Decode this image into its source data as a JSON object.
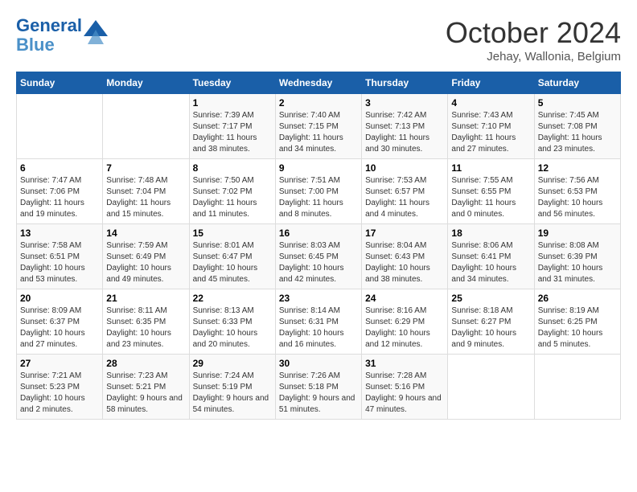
{
  "header": {
    "logo_general": "General",
    "logo_blue": "Blue",
    "month_title": "October 2024",
    "location": "Jehay, Wallonia, Belgium"
  },
  "weekdays": [
    "Sunday",
    "Monday",
    "Tuesday",
    "Wednesday",
    "Thursday",
    "Friday",
    "Saturday"
  ],
  "weeks": [
    [
      {
        "day": "",
        "sunrise": "",
        "sunset": "",
        "daylight": ""
      },
      {
        "day": "",
        "sunrise": "",
        "sunset": "",
        "daylight": ""
      },
      {
        "day": "1",
        "sunrise": "Sunrise: 7:39 AM",
        "sunset": "Sunset: 7:17 PM",
        "daylight": "Daylight: 11 hours and 38 minutes."
      },
      {
        "day": "2",
        "sunrise": "Sunrise: 7:40 AM",
        "sunset": "Sunset: 7:15 PM",
        "daylight": "Daylight: 11 hours and 34 minutes."
      },
      {
        "day": "3",
        "sunrise": "Sunrise: 7:42 AM",
        "sunset": "Sunset: 7:13 PM",
        "daylight": "Daylight: 11 hours and 30 minutes."
      },
      {
        "day": "4",
        "sunrise": "Sunrise: 7:43 AM",
        "sunset": "Sunset: 7:10 PM",
        "daylight": "Daylight: 11 hours and 27 minutes."
      },
      {
        "day": "5",
        "sunrise": "Sunrise: 7:45 AM",
        "sunset": "Sunset: 7:08 PM",
        "daylight": "Daylight: 11 hours and 23 minutes."
      }
    ],
    [
      {
        "day": "6",
        "sunrise": "Sunrise: 7:47 AM",
        "sunset": "Sunset: 7:06 PM",
        "daylight": "Daylight: 11 hours and 19 minutes."
      },
      {
        "day": "7",
        "sunrise": "Sunrise: 7:48 AM",
        "sunset": "Sunset: 7:04 PM",
        "daylight": "Daylight: 11 hours and 15 minutes."
      },
      {
        "day": "8",
        "sunrise": "Sunrise: 7:50 AM",
        "sunset": "Sunset: 7:02 PM",
        "daylight": "Daylight: 11 hours and 11 minutes."
      },
      {
        "day": "9",
        "sunrise": "Sunrise: 7:51 AM",
        "sunset": "Sunset: 7:00 PM",
        "daylight": "Daylight: 11 hours and 8 minutes."
      },
      {
        "day": "10",
        "sunrise": "Sunrise: 7:53 AM",
        "sunset": "Sunset: 6:57 PM",
        "daylight": "Daylight: 11 hours and 4 minutes."
      },
      {
        "day": "11",
        "sunrise": "Sunrise: 7:55 AM",
        "sunset": "Sunset: 6:55 PM",
        "daylight": "Daylight: 11 hours and 0 minutes."
      },
      {
        "day": "12",
        "sunrise": "Sunrise: 7:56 AM",
        "sunset": "Sunset: 6:53 PM",
        "daylight": "Daylight: 10 hours and 56 minutes."
      }
    ],
    [
      {
        "day": "13",
        "sunrise": "Sunrise: 7:58 AM",
        "sunset": "Sunset: 6:51 PM",
        "daylight": "Daylight: 10 hours and 53 minutes."
      },
      {
        "day": "14",
        "sunrise": "Sunrise: 7:59 AM",
        "sunset": "Sunset: 6:49 PM",
        "daylight": "Daylight: 10 hours and 49 minutes."
      },
      {
        "day": "15",
        "sunrise": "Sunrise: 8:01 AM",
        "sunset": "Sunset: 6:47 PM",
        "daylight": "Daylight: 10 hours and 45 minutes."
      },
      {
        "day": "16",
        "sunrise": "Sunrise: 8:03 AM",
        "sunset": "Sunset: 6:45 PM",
        "daylight": "Daylight: 10 hours and 42 minutes."
      },
      {
        "day": "17",
        "sunrise": "Sunrise: 8:04 AM",
        "sunset": "Sunset: 6:43 PM",
        "daylight": "Daylight: 10 hours and 38 minutes."
      },
      {
        "day": "18",
        "sunrise": "Sunrise: 8:06 AM",
        "sunset": "Sunset: 6:41 PM",
        "daylight": "Daylight: 10 hours and 34 minutes."
      },
      {
        "day": "19",
        "sunrise": "Sunrise: 8:08 AM",
        "sunset": "Sunset: 6:39 PM",
        "daylight": "Daylight: 10 hours and 31 minutes."
      }
    ],
    [
      {
        "day": "20",
        "sunrise": "Sunrise: 8:09 AM",
        "sunset": "Sunset: 6:37 PM",
        "daylight": "Daylight: 10 hours and 27 minutes."
      },
      {
        "day": "21",
        "sunrise": "Sunrise: 8:11 AM",
        "sunset": "Sunset: 6:35 PM",
        "daylight": "Daylight: 10 hours and 23 minutes."
      },
      {
        "day": "22",
        "sunrise": "Sunrise: 8:13 AM",
        "sunset": "Sunset: 6:33 PM",
        "daylight": "Daylight: 10 hours and 20 minutes."
      },
      {
        "day": "23",
        "sunrise": "Sunrise: 8:14 AM",
        "sunset": "Sunset: 6:31 PM",
        "daylight": "Daylight: 10 hours and 16 minutes."
      },
      {
        "day": "24",
        "sunrise": "Sunrise: 8:16 AM",
        "sunset": "Sunset: 6:29 PM",
        "daylight": "Daylight: 10 hours and 12 minutes."
      },
      {
        "day": "25",
        "sunrise": "Sunrise: 8:18 AM",
        "sunset": "Sunset: 6:27 PM",
        "daylight": "Daylight: 10 hours and 9 minutes."
      },
      {
        "day": "26",
        "sunrise": "Sunrise: 8:19 AM",
        "sunset": "Sunset: 6:25 PM",
        "daylight": "Daylight: 10 hours and 5 minutes."
      }
    ],
    [
      {
        "day": "27",
        "sunrise": "Sunrise: 7:21 AM",
        "sunset": "Sunset: 5:23 PM",
        "daylight": "Daylight: 10 hours and 2 minutes."
      },
      {
        "day": "28",
        "sunrise": "Sunrise: 7:23 AM",
        "sunset": "Sunset: 5:21 PM",
        "daylight": "Daylight: 9 hours and 58 minutes."
      },
      {
        "day": "29",
        "sunrise": "Sunrise: 7:24 AM",
        "sunset": "Sunset: 5:19 PM",
        "daylight": "Daylight: 9 hours and 54 minutes."
      },
      {
        "day": "30",
        "sunrise": "Sunrise: 7:26 AM",
        "sunset": "Sunset: 5:18 PM",
        "daylight": "Daylight: 9 hours and 51 minutes."
      },
      {
        "day": "31",
        "sunrise": "Sunrise: 7:28 AM",
        "sunset": "Sunset: 5:16 PM",
        "daylight": "Daylight: 9 hours and 47 minutes."
      },
      {
        "day": "",
        "sunrise": "",
        "sunset": "",
        "daylight": ""
      },
      {
        "day": "",
        "sunrise": "",
        "sunset": "",
        "daylight": ""
      }
    ]
  ]
}
